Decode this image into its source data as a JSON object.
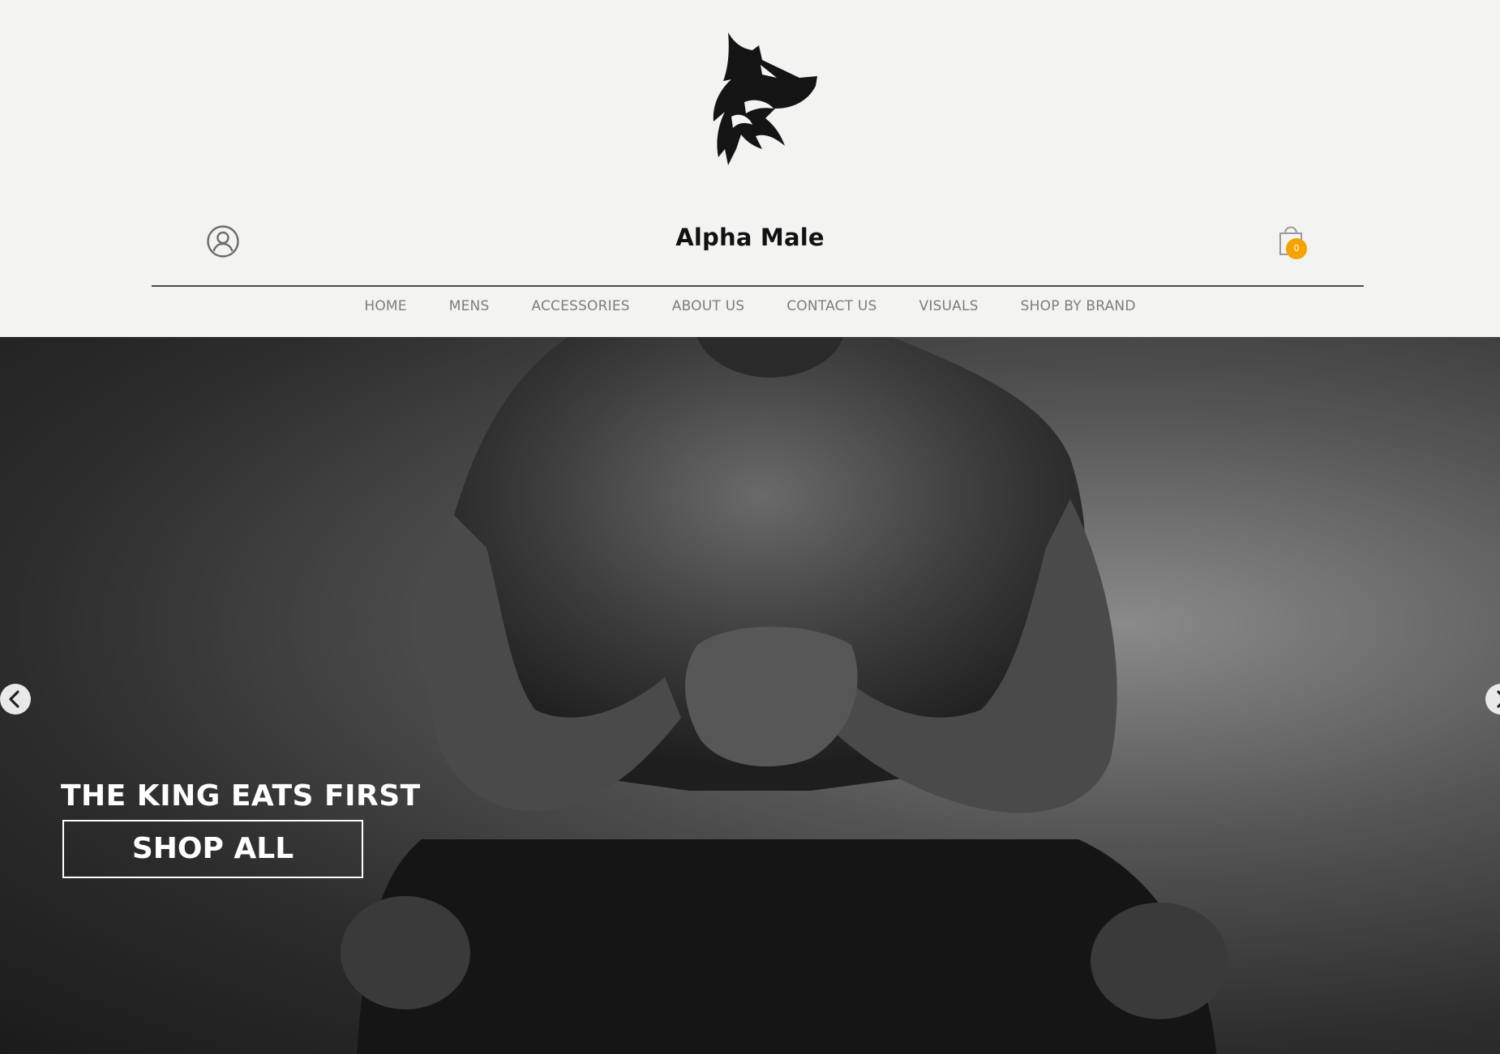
{
  "brand": {
    "name": "Alpha Male",
    "logo": "wolf-head-logo"
  },
  "header": {
    "account_icon": "user-circle-icon",
    "cart_icon": "shopping-bag-icon",
    "cart_count": "0",
    "cart_badge_color": "#f5a300"
  },
  "nav": {
    "items": [
      {
        "label": "HOME"
      },
      {
        "label": "MENS"
      },
      {
        "label": "ACCESSORIES"
      },
      {
        "label": "ABOUT US"
      },
      {
        "label": "CONTACT US"
      },
      {
        "label": "VISUALS"
      },
      {
        "label": "SHOP BY BRAND"
      }
    ]
  },
  "hero": {
    "title": "THE KING EATS FIRST",
    "button_label": "SHOP ALL",
    "prev_icon": "chevron-left-icon",
    "next_icon": "chevron-right-icon"
  }
}
